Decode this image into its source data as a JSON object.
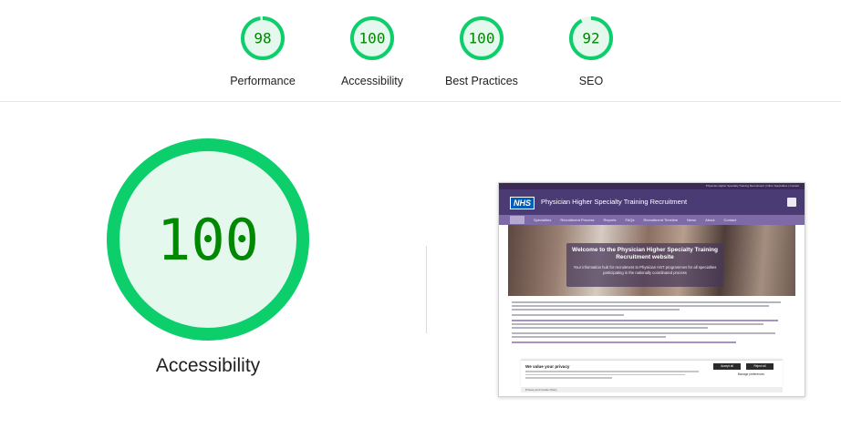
{
  "gauges": [
    {
      "score": "98",
      "fraction": 0.98,
      "label": "Performance"
    },
    {
      "score": "100",
      "fraction": 1.0,
      "label": "Accessibility"
    },
    {
      "score": "100",
      "fraction": 1.0,
      "label": "Best Practices"
    },
    {
      "score": "92",
      "fraction": 0.92,
      "label": "SEO"
    }
  ],
  "main": {
    "score": "100",
    "fraction": 1.0,
    "label": "Accessibility"
  },
  "colors": {
    "pass": "#0cce6b",
    "pass_fill": "#e5f8ed",
    "score_text": "#008800"
  },
  "thumbnail": {
    "logo": "NHS",
    "site_title": "Physician Higher Specialty Training Recruitment",
    "utility_links": "Physician Higher Specialty Training Recruitment | Other Specialties | Contact",
    "nav": [
      "Specialties",
      "Recruitment Process",
      "Reports",
      "FAQs",
      "Recruitment Timeline",
      "News",
      "About",
      "Contact"
    ],
    "hero_title": "Welcome to the Physician Higher Specialty Training Recruitment website",
    "hero_subtitle": "Your information hub for recruitment to Physician HST programmes for all specialties participating in the nationally coordinated process",
    "cookie_title": "We value your privacy",
    "cookie_accept": "Accept all",
    "cookie_reject": "Reject all",
    "cookie_manage": "Manage preferences",
    "cookie_footer": "Privacy and Cookie Policy"
  }
}
